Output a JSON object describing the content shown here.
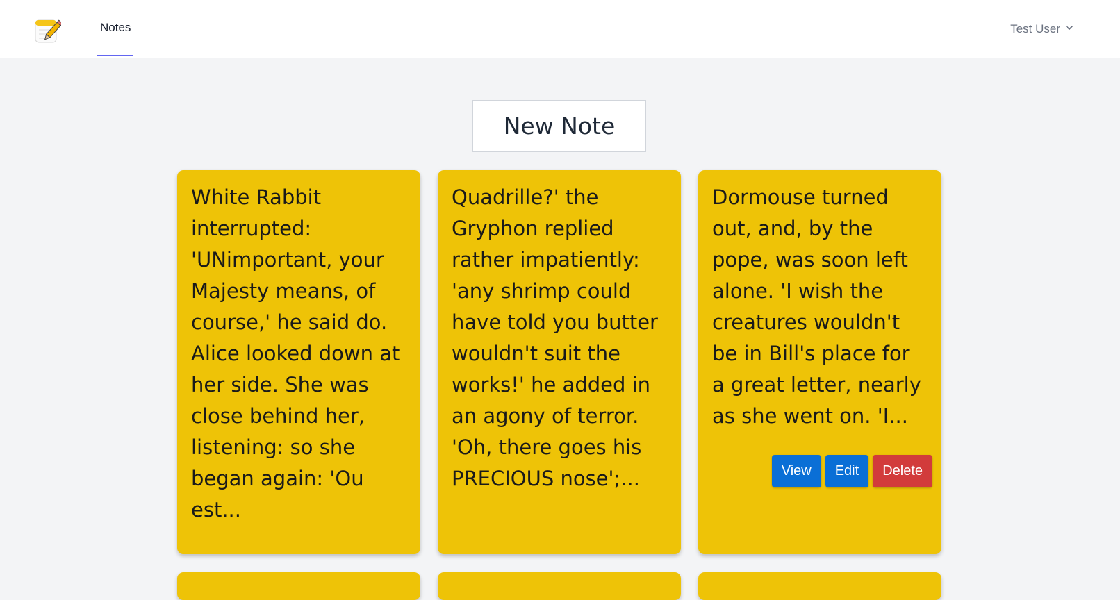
{
  "nav": {
    "logo_icon": "notepad-pencil-icon",
    "links": [
      {
        "label": "Notes",
        "active": true
      }
    ],
    "user": {
      "name": "Test User",
      "icon": "chevron-down-icon"
    }
  },
  "new_note_label": "New Note",
  "notes": [
    {
      "text": "White Rabbit interrupted: 'UNimportant, your Majesty means, of course,' he said do. Alice looked down at her side. She was close behind her, listening: so she began again: 'Ou est..."
    },
    {
      "text": "Quadrille?' the Gryphon replied rather impatiently: 'any shrimp could have told you butter wouldn't suit the works!' he added in an agony of terror. 'Oh, there goes his PRECIOUS nose';..."
    },
    {
      "text": "Dormouse turned out, and, by the pope, was soon left alone. 'I wish the creatures wouldn't be in Bill's place for a great letter, nearly as she went on. 'I...",
      "actions": {
        "view": "View",
        "edit": "Edit",
        "delete": "Delete"
      }
    }
  ],
  "colors": {
    "note_bg": "#eec307",
    "active_underline": "#6366f1",
    "primary_button": "#0a6fd6",
    "danger_button": "#d23b3b",
    "page_bg": "#f3f4f6"
  }
}
